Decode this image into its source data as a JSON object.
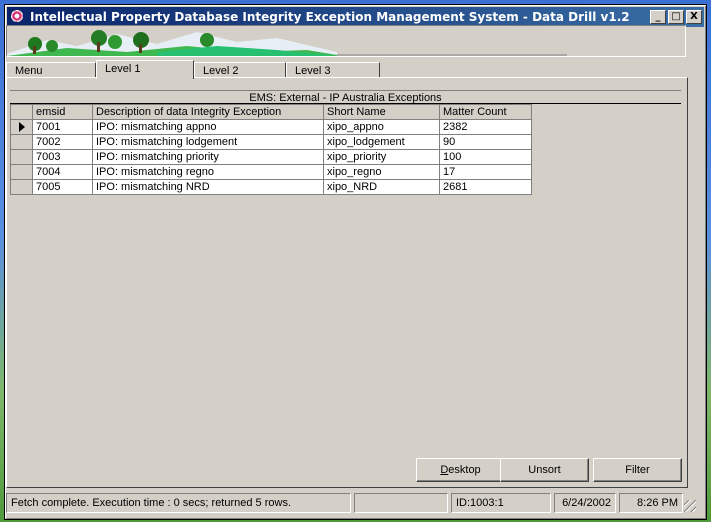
{
  "window": {
    "title": "Intellectual Property Database Integrity Exception Management System - Data Drill v1.2"
  },
  "window_buttons": {
    "minimize": "_",
    "maximize": "□",
    "close": "X"
  },
  "tabs": [
    {
      "label": "Menu"
    },
    {
      "label": "Level 1"
    },
    {
      "label": "Level 2"
    },
    {
      "label": "Level 3"
    }
  ],
  "active_tab": "Level 1",
  "grid": {
    "caption": "EMS: External - IP Australia Exceptions",
    "columns": [
      "emsid",
      "Description of data Integrity Exception",
      "Short Name",
      "Matter Count"
    ],
    "rows": [
      [
        "7001",
        "IPO: mismatching appno",
        "xipo_appno",
        "2382"
      ],
      [
        "7002",
        "IPO: mismatching lodgement",
        "xipo_lodgement",
        "90"
      ],
      [
        "7003",
        "IPO: mismatching priority",
        "xipo_priority",
        "100"
      ],
      [
        "7004",
        "IPO: mismatching regno",
        "xipo_regno",
        "17"
      ],
      [
        "7005",
        "IPO: mismatching NRD",
        "xipo_NRD",
        "2681"
      ]
    ],
    "current_row": 0
  },
  "buttons": {
    "desktop": "Desktop",
    "unsort": "Unsort",
    "filter": "Filter"
  },
  "status": {
    "message": "Fetch complete.  Execution time : 0 secs; returned 5 rows.",
    "empty": "",
    "id": "ID:1003:1",
    "date": "6/24/2002",
    "time": "8:26 PM"
  },
  "colors": {
    "titlebar": "#0a246a",
    "face": "#d4d0c8"
  }
}
